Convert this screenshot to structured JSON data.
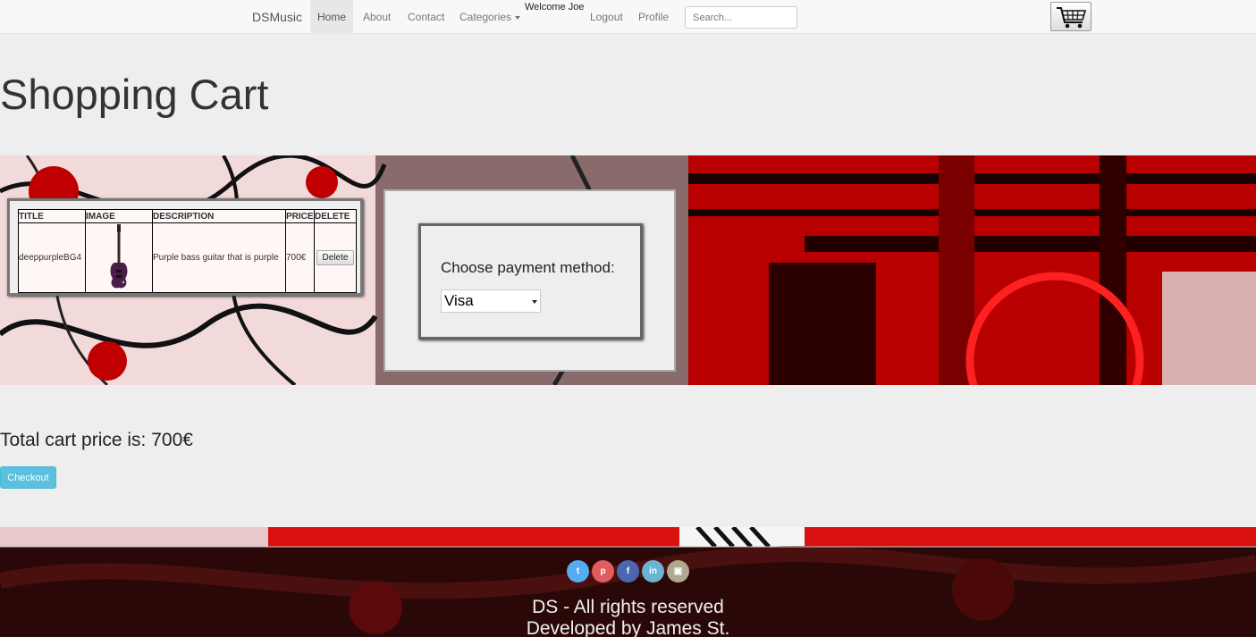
{
  "nav": {
    "brand": "DSMusic",
    "home": "Home",
    "about": "About",
    "contact": "Contact",
    "categories": "Categories",
    "welcome": "Welcome Joe",
    "logout": "Logout",
    "profile": "Profile",
    "search_placeholder": "Search..."
  },
  "page": {
    "title": "Shopping Cart"
  },
  "cart": {
    "columns": [
      "TITLE",
      "IMAGE",
      "DESCRIPTION",
      "PRICE",
      "DELETE"
    ],
    "items": [
      {
        "title": "deeppurpleBG4",
        "description": "Purple bass guitar that is purple",
        "price": "700€",
        "delete_label": "Delete"
      }
    ]
  },
  "payment": {
    "label": "Choose payment method:",
    "selected": "Visa"
  },
  "summary": {
    "total": "Total cart price is: 700€",
    "checkout_label": "Checkout"
  },
  "footer": {
    "socials": [
      "twitter-icon",
      "pinterest-icon",
      "facebook-icon",
      "linkedin-icon",
      "instagram-icon"
    ],
    "social_colors": [
      "#55acee",
      "#e05d5d",
      "#4a67b0",
      "#6ab4d4",
      "#b0a890"
    ],
    "rights": "DS - All rights reserved",
    "developer": "Developed by James St."
  }
}
